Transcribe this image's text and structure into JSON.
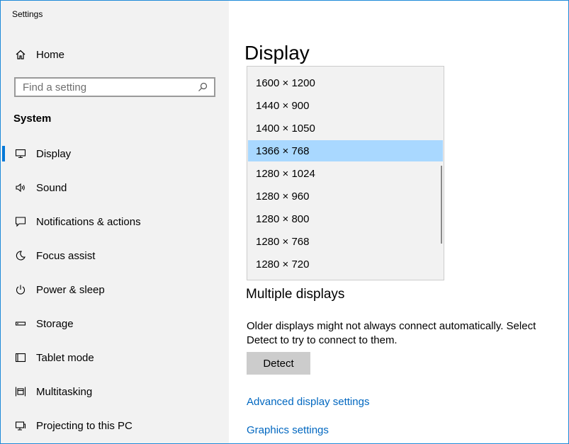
{
  "window": {
    "title": "Settings"
  },
  "sidebar": {
    "home_label": "Home",
    "search_placeholder": "Find a setting",
    "section_title": "System",
    "items": [
      {
        "label": "Display",
        "icon": "monitor-icon",
        "active": true
      },
      {
        "label": "Sound",
        "icon": "speaker-icon"
      },
      {
        "label": "Notifications & actions",
        "icon": "notification-icon"
      },
      {
        "label": "Focus assist",
        "icon": "moon-icon"
      },
      {
        "label": "Power & sleep",
        "icon": "power-icon"
      },
      {
        "label": "Storage",
        "icon": "storage-icon"
      },
      {
        "label": "Tablet mode",
        "icon": "tablet-icon"
      },
      {
        "label": "Multitasking",
        "icon": "multitasking-icon"
      },
      {
        "label": "Projecting to this PC",
        "icon": "projecting-icon"
      }
    ]
  },
  "main": {
    "title": "Display",
    "resolutions": [
      "1600 × 1200",
      "1440 × 900",
      "1400 × 1050",
      "1366 × 768",
      "1280 × 1024",
      "1280 × 960",
      "1280 × 800",
      "1280 × 768",
      "1280 × 720"
    ],
    "selected_resolution": "1366 × 768",
    "multiple_displays": {
      "heading": "Multiple displays",
      "description": "Older displays might not always connect automatically. Select Detect to try to connect to them.",
      "detect_label": "Detect"
    },
    "links": {
      "advanced": "Advanced display settings",
      "graphics": "Graphics settings"
    }
  },
  "colors": {
    "accent": "#0078d7",
    "selection": "#a9d8ff",
    "link": "#0067c0",
    "sidebar_bg": "#f2f2f2"
  }
}
